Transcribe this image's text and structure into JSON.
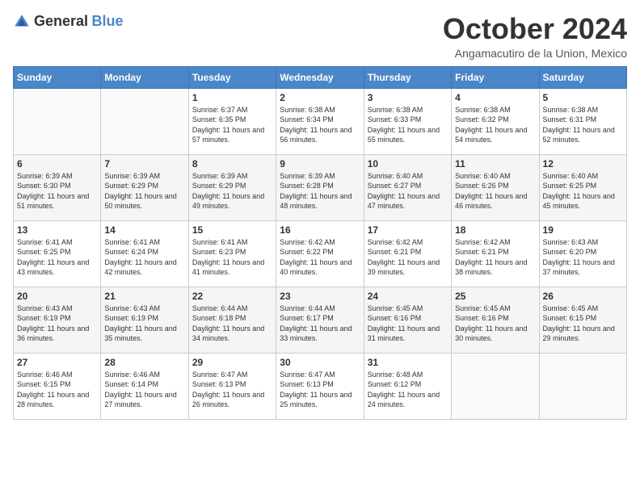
{
  "logo": {
    "general": "General",
    "blue": "Blue"
  },
  "title": "October 2024",
  "subtitle": "Angamacutiro de la Union, Mexico",
  "days_of_week": [
    "Sunday",
    "Monday",
    "Tuesday",
    "Wednesday",
    "Thursday",
    "Friday",
    "Saturday"
  ],
  "weeks": [
    [
      {
        "day": "",
        "sunrise": "",
        "sunset": "",
        "daylight": ""
      },
      {
        "day": "",
        "sunrise": "",
        "sunset": "",
        "daylight": ""
      },
      {
        "day": "1",
        "sunrise": "Sunrise: 6:37 AM",
        "sunset": "Sunset: 6:35 PM",
        "daylight": "Daylight: 11 hours and 57 minutes."
      },
      {
        "day": "2",
        "sunrise": "Sunrise: 6:38 AM",
        "sunset": "Sunset: 6:34 PM",
        "daylight": "Daylight: 11 hours and 56 minutes."
      },
      {
        "day": "3",
        "sunrise": "Sunrise: 6:38 AM",
        "sunset": "Sunset: 6:33 PM",
        "daylight": "Daylight: 11 hours and 55 minutes."
      },
      {
        "day": "4",
        "sunrise": "Sunrise: 6:38 AM",
        "sunset": "Sunset: 6:32 PM",
        "daylight": "Daylight: 11 hours and 54 minutes."
      },
      {
        "day": "5",
        "sunrise": "Sunrise: 6:38 AM",
        "sunset": "Sunset: 6:31 PM",
        "daylight": "Daylight: 11 hours and 52 minutes."
      }
    ],
    [
      {
        "day": "6",
        "sunrise": "Sunrise: 6:39 AM",
        "sunset": "Sunset: 6:30 PM",
        "daylight": "Daylight: 11 hours and 51 minutes."
      },
      {
        "day": "7",
        "sunrise": "Sunrise: 6:39 AM",
        "sunset": "Sunset: 6:29 PM",
        "daylight": "Daylight: 11 hours and 50 minutes."
      },
      {
        "day": "8",
        "sunrise": "Sunrise: 6:39 AM",
        "sunset": "Sunset: 6:29 PM",
        "daylight": "Daylight: 11 hours and 49 minutes."
      },
      {
        "day": "9",
        "sunrise": "Sunrise: 6:39 AM",
        "sunset": "Sunset: 6:28 PM",
        "daylight": "Daylight: 11 hours and 48 minutes."
      },
      {
        "day": "10",
        "sunrise": "Sunrise: 6:40 AM",
        "sunset": "Sunset: 6:27 PM",
        "daylight": "Daylight: 11 hours and 47 minutes."
      },
      {
        "day": "11",
        "sunrise": "Sunrise: 6:40 AM",
        "sunset": "Sunset: 6:26 PM",
        "daylight": "Daylight: 11 hours and 46 minutes."
      },
      {
        "day": "12",
        "sunrise": "Sunrise: 6:40 AM",
        "sunset": "Sunset: 6:25 PM",
        "daylight": "Daylight: 11 hours and 45 minutes."
      }
    ],
    [
      {
        "day": "13",
        "sunrise": "Sunrise: 6:41 AM",
        "sunset": "Sunset: 6:25 PM",
        "daylight": "Daylight: 11 hours and 43 minutes."
      },
      {
        "day": "14",
        "sunrise": "Sunrise: 6:41 AM",
        "sunset": "Sunset: 6:24 PM",
        "daylight": "Daylight: 11 hours and 42 minutes."
      },
      {
        "day": "15",
        "sunrise": "Sunrise: 6:41 AM",
        "sunset": "Sunset: 6:23 PM",
        "daylight": "Daylight: 11 hours and 41 minutes."
      },
      {
        "day": "16",
        "sunrise": "Sunrise: 6:42 AM",
        "sunset": "Sunset: 6:22 PM",
        "daylight": "Daylight: 11 hours and 40 minutes."
      },
      {
        "day": "17",
        "sunrise": "Sunrise: 6:42 AM",
        "sunset": "Sunset: 6:21 PM",
        "daylight": "Daylight: 11 hours and 39 minutes."
      },
      {
        "day": "18",
        "sunrise": "Sunrise: 6:42 AM",
        "sunset": "Sunset: 6:21 PM",
        "daylight": "Daylight: 11 hours and 38 minutes."
      },
      {
        "day": "19",
        "sunrise": "Sunrise: 6:43 AM",
        "sunset": "Sunset: 6:20 PM",
        "daylight": "Daylight: 11 hours and 37 minutes."
      }
    ],
    [
      {
        "day": "20",
        "sunrise": "Sunrise: 6:43 AM",
        "sunset": "Sunset: 6:19 PM",
        "daylight": "Daylight: 11 hours and 36 minutes."
      },
      {
        "day": "21",
        "sunrise": "Sunrise: 6:43 AM",
        "sunset": "Sunset: 6:19 PM",
        "daylight": "Daylight: 11 hours and 35 minutes."
      },
      {
        "day": "22",
        "sunrise": "Sunrise: 6:44 AM",
        "sunset": "Sunset: 6:18 PM",
        "daylight": "Daylight: 11 hours and 34 minutes."
      },
      {
        "day": "23",
        "sunrise": "Sunrise: 6:44 AM",
        "sunset": "Sunset: 6:17 PM",
        "daylight": "Daylight: 11 hours and 33 minutes."
      },
      {
        "day": "24",
        "sunrise": "Sunrise: 6:45 AM",
        "sunset": "Sunset: 6:16 PM",
        "daylight": "Daylight: 11 hours and 31 minutes."
      },
      {
        "day": "25",
        "sunrise": "Sunrise: 6:45 AM",
        "sunset": "Sunset: 6:16 PM",
        "daylight": "Daylight: 11 hours and 30 minutes."
      },
      {
        "day": "26",
        "sunrise": "Sunrise: 6:45 AM",
        "sunset": "Sunset: 6:15 PM",
        "daylight": "Daylight: 11 hours and 29 minutes."
      }
    ],
    [
      {
        "day": "27",
        "sunrise": "Sunrise: 6:46 AM",
        "sunset": "Sunset: 6:15 PM",
        "daylight": "Daylight: 11 hours and 28 minutes."
      },
      {
        "day": "28",
        "sunrise": "Sunrise: 6:46 AM",
        "sunset": "Sunset: 6:14 PM",
        "daylight": "Daylight: 11 hours and 27 minutes."
      },
      {
        "day": "29",
        "sunrise": "Sunrise: 6:47 AM",
        "sunset": "Sunset: 6:13 PM",
        "daylight": "Daylight: 11 hours and 26 minutes."
      },
      {
        "day": "30",
        "sunrise": "Sunrise: 6:47 AM",
        "sunset": "Sunset: 6:13 PM",
        "daylight": "Daylight: 11 hours and 25 minutes."
      },
      {
        "day": "31",
        "sunrise": "Sunrise: 6:48 AM",
        "sunset": "Sunset: 6:12 PM",
        "daylight": "Daylight: 11 hours and 24 minutes."
      },
      {
        "day": "",
        "sunrise": "",
        "sunset": "",
        "daylight": ""
      },
      {
        "day": "",
        "sunrise": "",
        "sunset": "",
        "daylight": ""
      }
    ]
  ]
}
